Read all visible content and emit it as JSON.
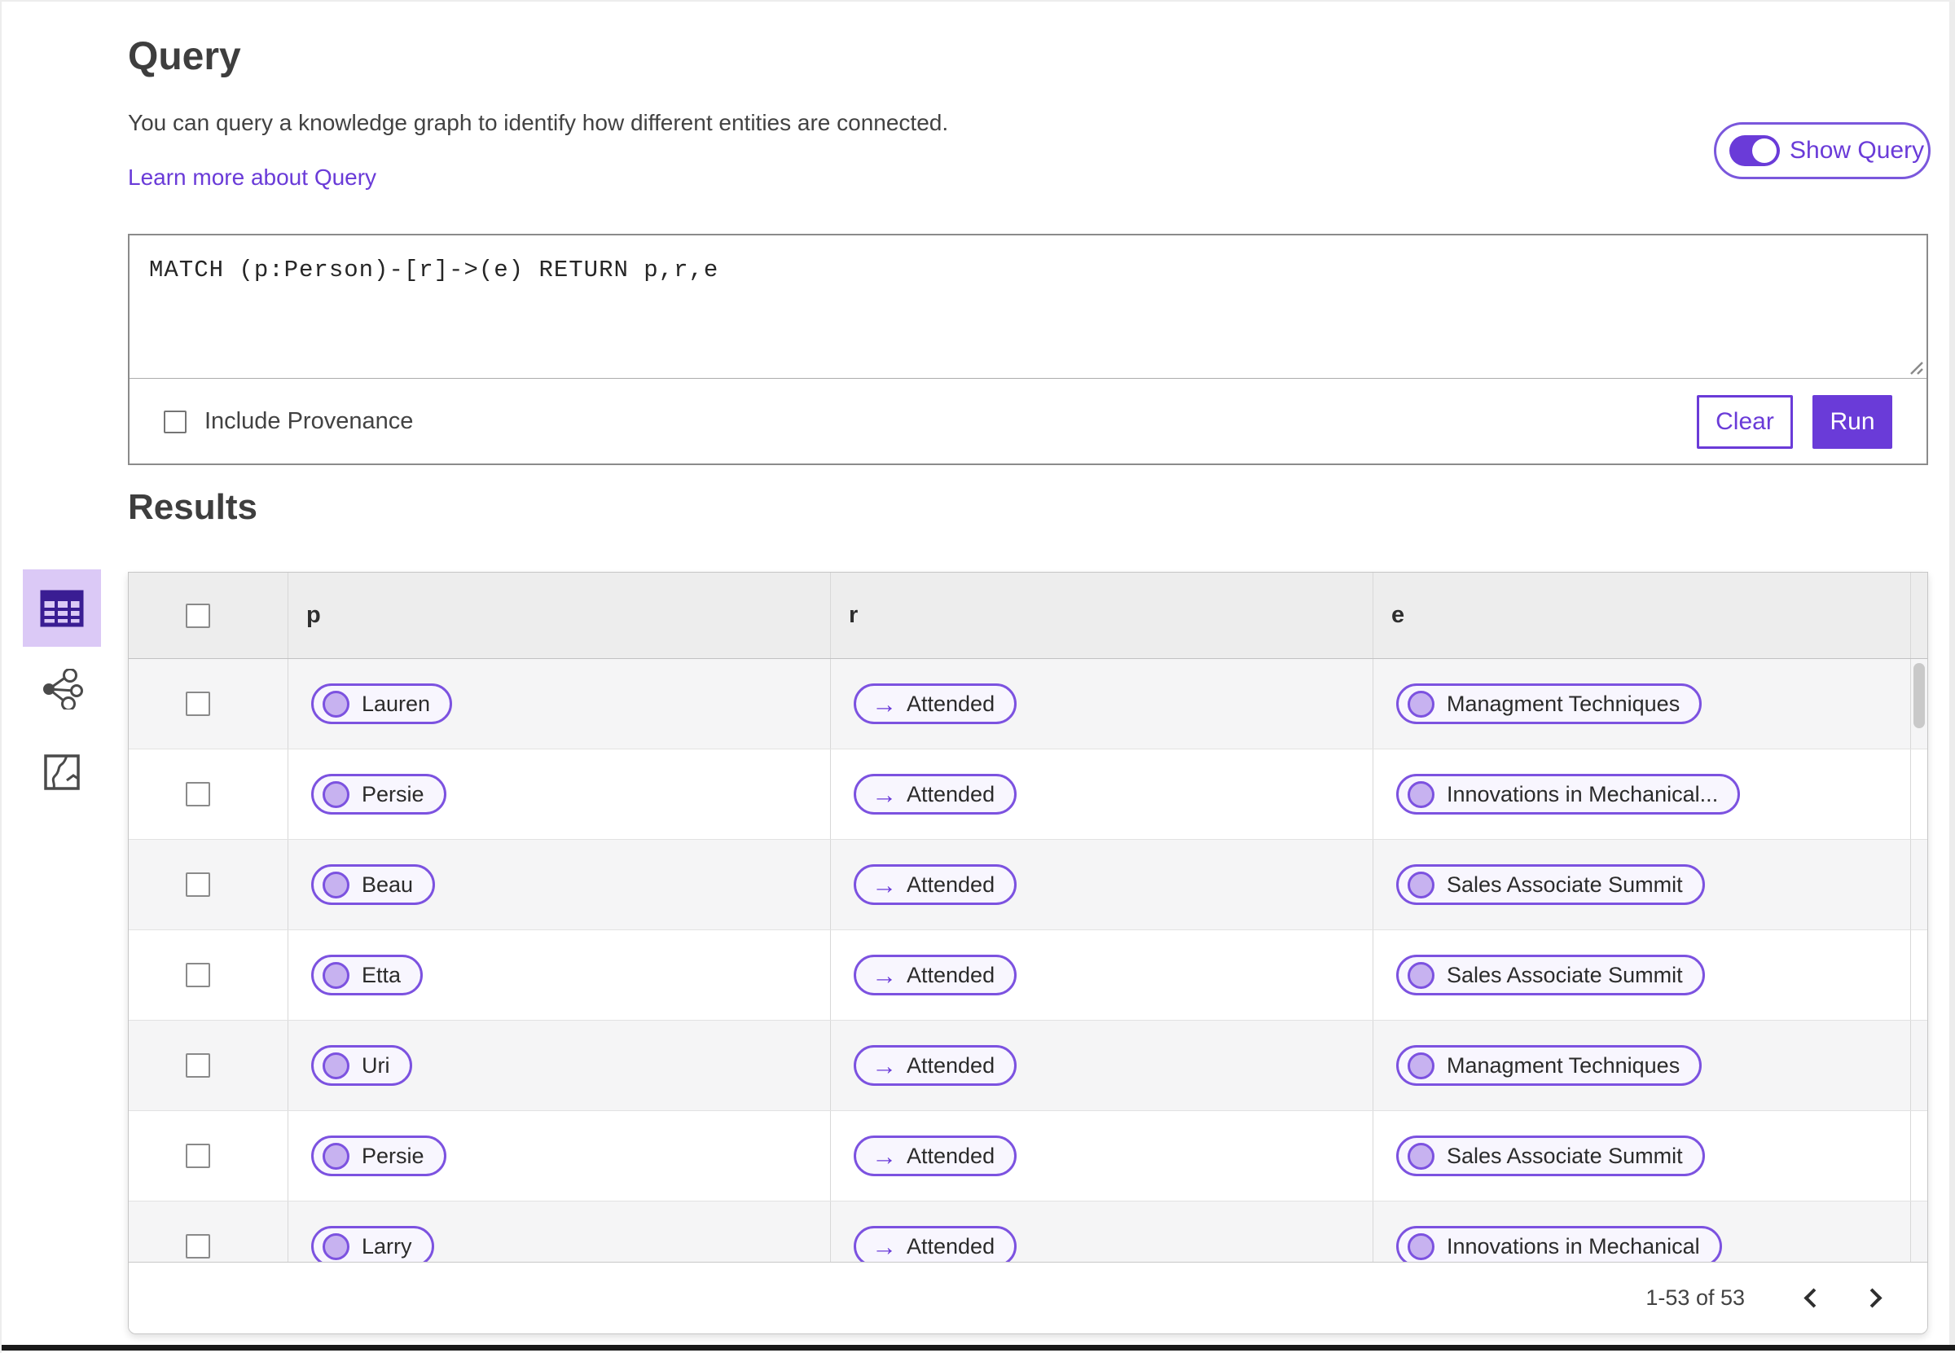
{
  "colors": {
    "accent_purple": "#6A3BD8",
    "pill_border": "#7C52E0",
    "pill_circle_fill": "#C7B2F0",
    "pill_background": "#F8F6FE",
    "selected_view_background": "#DBC9F6",
    "selected_view_icon": "#3A1D93",
    "table_header_background": "#EDEDED",
    "row_stripe_background": "#F5F5F6",
    "run_button_text": "#FFFFFF"
  },
  "query": {
    "title": "Query",
    "description": "You can query a knowledge graph to identify how different entities are connected.",
    "learn_more_link": "Learn more about Query",
    "show_query_toggle": {
      "label": "Show Query",
      "state": "on"
    },
    "editor": {
      "text": "MATCH (p:Person)-[r]->(e) RETURN p,r,e"
    },
    "include_provenance": {
      "label": "Include Provenance",
      "checked": false
    },
    "buttons": {
      "clear": "Clear",
      "run": "Run"
    }
  },
  "results": {
    "title": "Results",
    "views": [
      {
        "name": "table-view",
        "selected": true
      },
      {
        "name": "network-view",
        "selected": false
      },
      {
        "name": "map-view",
        "selected": false
      }
    ],
    "table": {
      "columns": [
        "p",
        "r",
        "e"
      ],
      "rows": [
        {
          "p": "Lauren",
          "r": "Attended",
          "e": "Managment Techniques"
        },
        {
          "p": "Persie",
          "r": "Attended",
          "e": "Innovations in Mechanical..."
        },
        {
          "p": "Beau",
          "r": "Attended",
          "e": "Sales Associate Summit"
        },
        {
          "p": "Etta",
          "r": "Attended",
          "e": "Sales Associate Summit"
        },
        {
          "p": "Uri",
          "r": "Attended",
          "e": "Managment Techniques"
        },
        {
          "p": "Persie",
          "r": "Attended",
          "e": "Sales Associate Summit"
        },
        {
          "p": "Larry",
          "r": "Attended",
          "e": "Innovations in Mechanical"
        }
      ]
    },
    "pagination": {
      "range_text": "1-53 of 53",
      "prev_icon": "chevron-left",
      "next_icon": "chevron-right"
    }
  },
  "icons": {
    "relationship_arrow": "→"
  }
}
